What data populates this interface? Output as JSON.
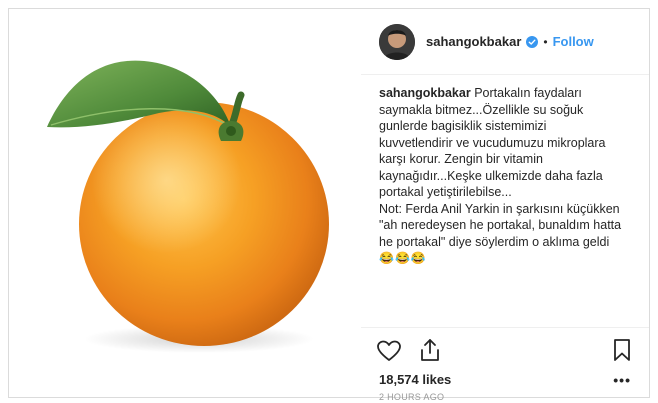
{
  "post": {
    "username": "sahangokbakar",
    "follow_label": "Follow",
    "separator": "•",
    "caption_user": "sahangokbakar",
    "caption_lines": [
      "Portakalın faydaları",
      "saymakla bitmez...Özellikle su soğuk",
      "gunlerde bagisiklik sistemimizi",
      "kuvvetlendirir ve vucudumuzu mikroplara",
      "karşı korur. Zengin bir vitamin",
      "kaynağıdır...Keşke ulkemizde daha fazla",
      "portakal yetiştirilebilse...",
      "Not: Ferda Anil Yarkin in şarkısını küçükken",
      "\"ah neredeysen he portakal, bunaldım hatta",
      "he portakal\" diye söylerdim o aklıma geldi"
    ],
    "emojis": "😂😂😂",
    "likes": "18,574 likes",
    "more": "•••",
    "time": "2 HOURS AGO"
  },
  "icons": {
    "avatar": "avatar-image",
    "verified": "verified-badge-icon",
    "like": "heart-icon",
    "share": "share-icon",
    "save": "bookmark-icon",
    "more": "more-options-icon"
  },
  "colors": {
    "link": "#3897f0",
    "text": "#262626",
    "orange": "#f5961e",
    "leaf": "#4f8a3a"
  }
}
